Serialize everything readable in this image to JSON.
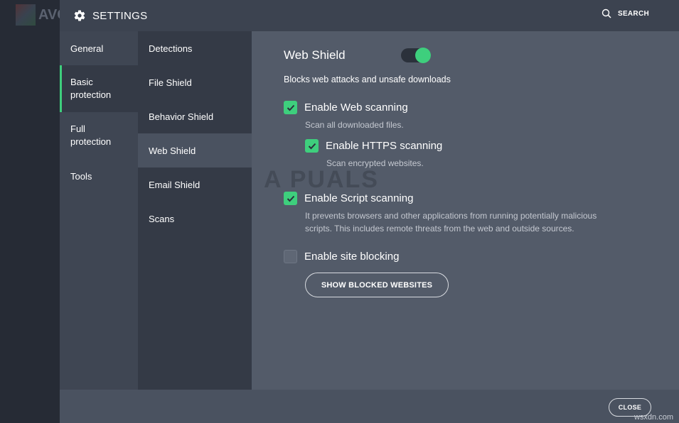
{
  "app": {
    "brand": "AVG"
  },
  "header": {
    "title": "SETTINGS",
    "search_label": "SEARCH"
  },
  "categories": [
    {
      "label": "General"
    },
    {
      "label": "Basic protection",
      "active": true
    },
    {
      "label": "Full protection"
    },
    {
      "label": "Tools"
    }
  ],
  "subnav": [
    {
      "label": "Detections"
    },
    {
      "label": "File Shield"
    },
    {
      "label": "Behavior Shield"
    },
    {
      "label": "Web Shield",
      "active": true
    },
    {
      "label": "Email Shield"
    },
    {
      "label": "Scans"
    }
  ],
  "web_shield": {
    "title": "Web Shield",
    "enabled": true,
    "description": "Blocks web attacks and unsafe downloads",
    "options": {
      "web_scanning": {
        "label": "Enable Web scanning",
        "checked": true,
        "sub": "Scan all downloaded files."
      },
      "https_scanning": {
        "label": "Enable HTTPS scanning",
        "checked": true,
        "sub": "Scan encrypted websites."
      },
      "script_scanning": {
        "label": "Enable Script scanning",
        "checked": true,
        "sub1": "It prevents browsers and other applications from running potentially malicious",
        "sub2": "scripts. This includes remote threats from the web and outside sources."
      },
      "site_blocking": {
        "label": "Enable site blocking",
        "checked": false
      }
    },
    "show_blocked_label": "SHOW BLOCKED WEBSITES"
  },
  "footer": {
    "close_label": "CLOSE"
  },
  "watermark": "A PUALS",
  "corner_mark": "wsxdn.com",
  "colors": {
    "accent": "#3ecf7d",
    "header_bg": "#3c4350",
    "content_bg": "#535b69"
  },
  "icons": {
    "settings": "gear-icon",
    "search": "search-icon",
    "check": "check-icon"
  }
}
